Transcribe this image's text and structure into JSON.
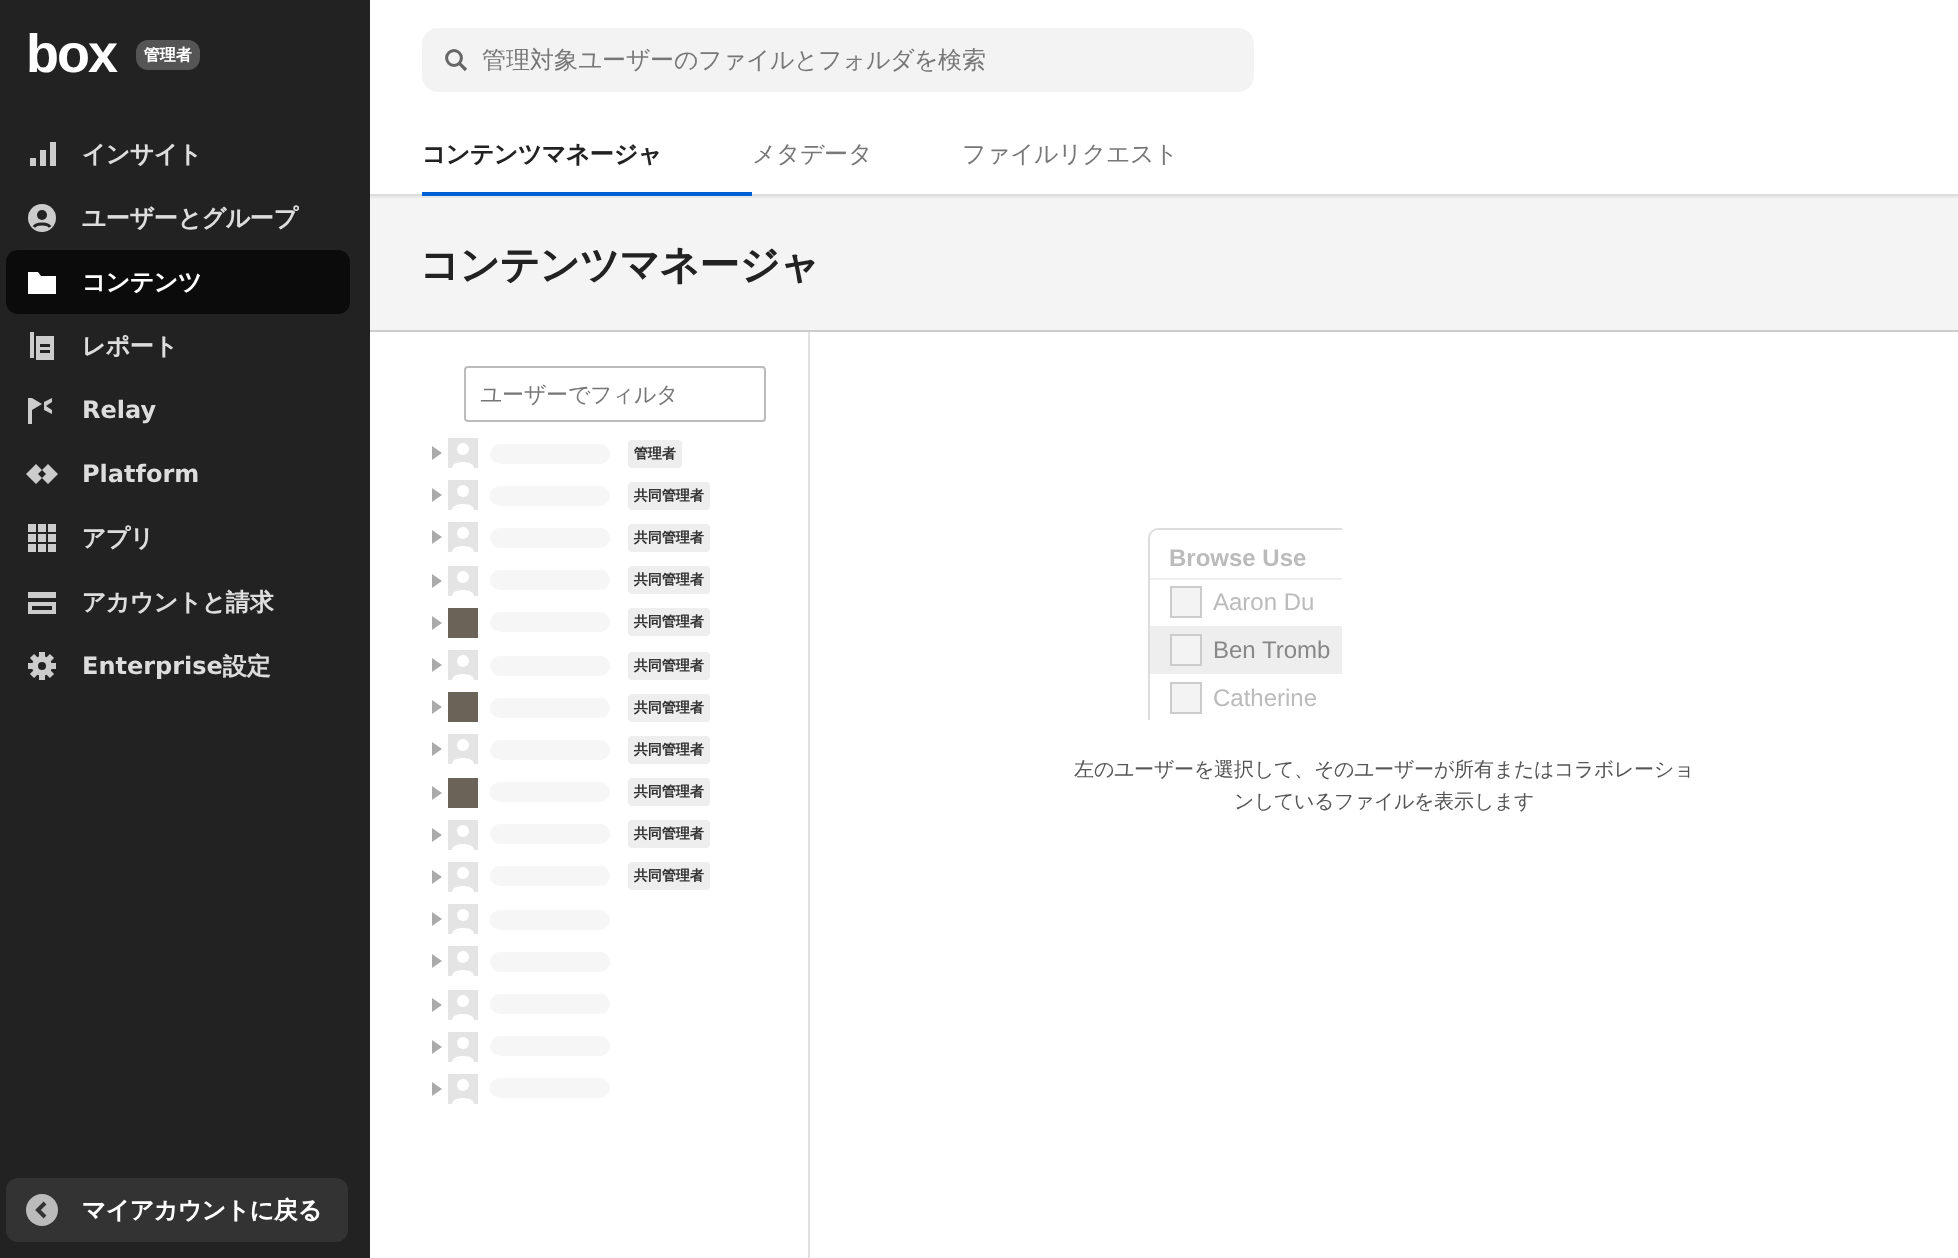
{
  "sidebar": {
    "logo": "box",
    "badge": "管理者",
    "items": [
      {
        "kind": "chart",
        "label": "インサイト",
        "selected": false
      },
      {
        "kind": "user",
        "label": "ユーザーとグループ",
        "selected": false
      },
      {
        "kind": "folder",
        "label": "コンテンツ",
        "selected": true
      },
      {
        "kind": "report",
        "label": "レポート",
        "selected": false
      },
      {
        "kind": "relay",
        "label": "Relay",
        "selected": false
      },
      {
        "kind": "platform",
        "label": "Platform",
        "selected": false
      },
      {
        "kind": "apps",
        "label": "アプリ",
        "selected": false
      },
      {
        "kind": "card",
        "label": "アカウントと請求",
        "selected": false
      },
      {
        "kind": "gear",
        "label": "Enterprise設定",
        "selected": false
      }
    ],
    "back_button": "マイアカウントに戻る"
  },
  "search": {
    "placeholder": "管理対象ユーザーのファイルとフォルダを検索"
  },
  "tabs": [
    {
      "label": "コンテンツマネージャ",
      "selected": true
    },
    {
      "label": "メタデータ",
      "selected": false
    },
    {
      "label": "ファイルリクエスト",
      "selected": false
    }
  ],
  "page_title": "コンテンツマネージャ",
  "user_filter": {
    "placeholder": "ユーザーでフィルタ"
  },
  "users": [
    {
      "kind": "generic",
      "badge": "管理者"
    },
    {
      "kind": "generic",
      "badge": "共同管理者"
    },
    {
      "kind": "generic",
      "badge": "共同管理者"
    },
    {
      "kind": "generic",
      "badge": "共同管理者"
    },
    {
      "kind": "photo",
      "badge": "共同管理者"
    },
    {
      "kind": "generic",
      "badge": "共同管理者"
    },
    {
      "kind": "photo",
      "badge": "共同管理者"
    },
    {
      "kind": "generic",
      "badge": "共同管理者"
    },
    {
      "kind": "photo",
      "badge": "共同管理者"
    },
    {
      "kind": "generic",
      "badge": "共同管理者"
    },
    {
      "kind": "generic",
      "badge": "共同管理者"
    },
    {
      "kind": "generic"
    },
    {
      "kind": "generic"
    },
    {
      "kind": "generic"
    },
    {
      "kind": "generic"
    },
    {
      "kind": "generic"
    }
  ],
  "illustration": {
    "title": "Browse Use",
    "names": [
      {
        "name": "Aaron Du",
        "selected": false
      },
      {
        "name": "Ben Tromb",
        "selected": true
      },
      {
        "name": "Catherine",
        "selected": false
      }
    ]
  },
  "empty_message": "左のユーザーを選択して、そのユーザーが所有またはコラボレーションしているファイルを表示します"
}
